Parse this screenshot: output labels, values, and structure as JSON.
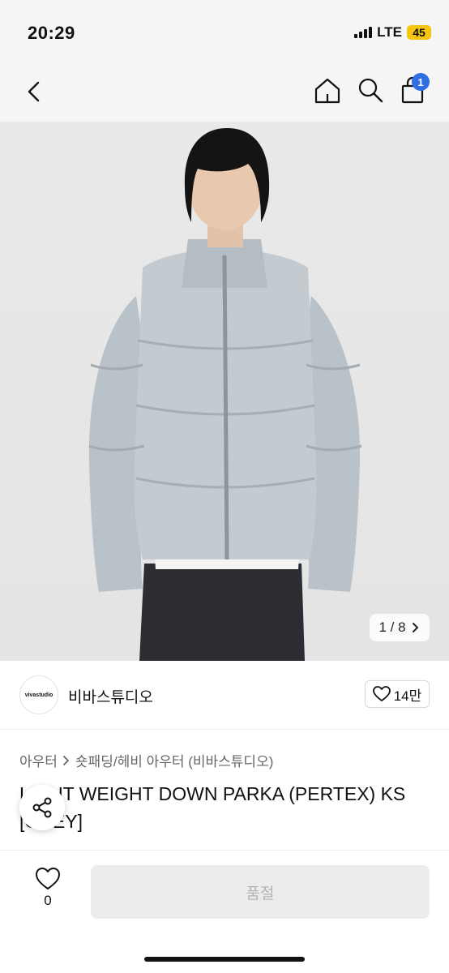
{
  "status": {
    "time": "20:29",
    "network": "LTE",
    "battery": "45"
  },
  "nav": {
    "cart_count": "1"
  },
  "gallery": {
    "counter": "1 / 8",
    "next_icon": "chevron-right-icon"
  },
  "seller": {
    "logo_text": "vivastudio",
    "name": "비바스튜디오",
    "likes": "14만"
  },
  "breadcrumb": {
    "level1": "아우터",
    "level2": "숏패딩/헤비 아우터 (비바스튜디오)"
  },
  "product": {
    "title": "LIGHT WEIGHT DOWN PARKA (PERTEX) KS [GREY]"
  },
  "bottom": {
    "wish_count": "0",
    "purchase_label": "품절"
  },
  "colors": {
    "accent": "#2f6fe4",
    "battery": "#f4c60f",
    "disabled_bg": "#ececec",
    "disabled_text": "#b3b3b3"
  }
}
